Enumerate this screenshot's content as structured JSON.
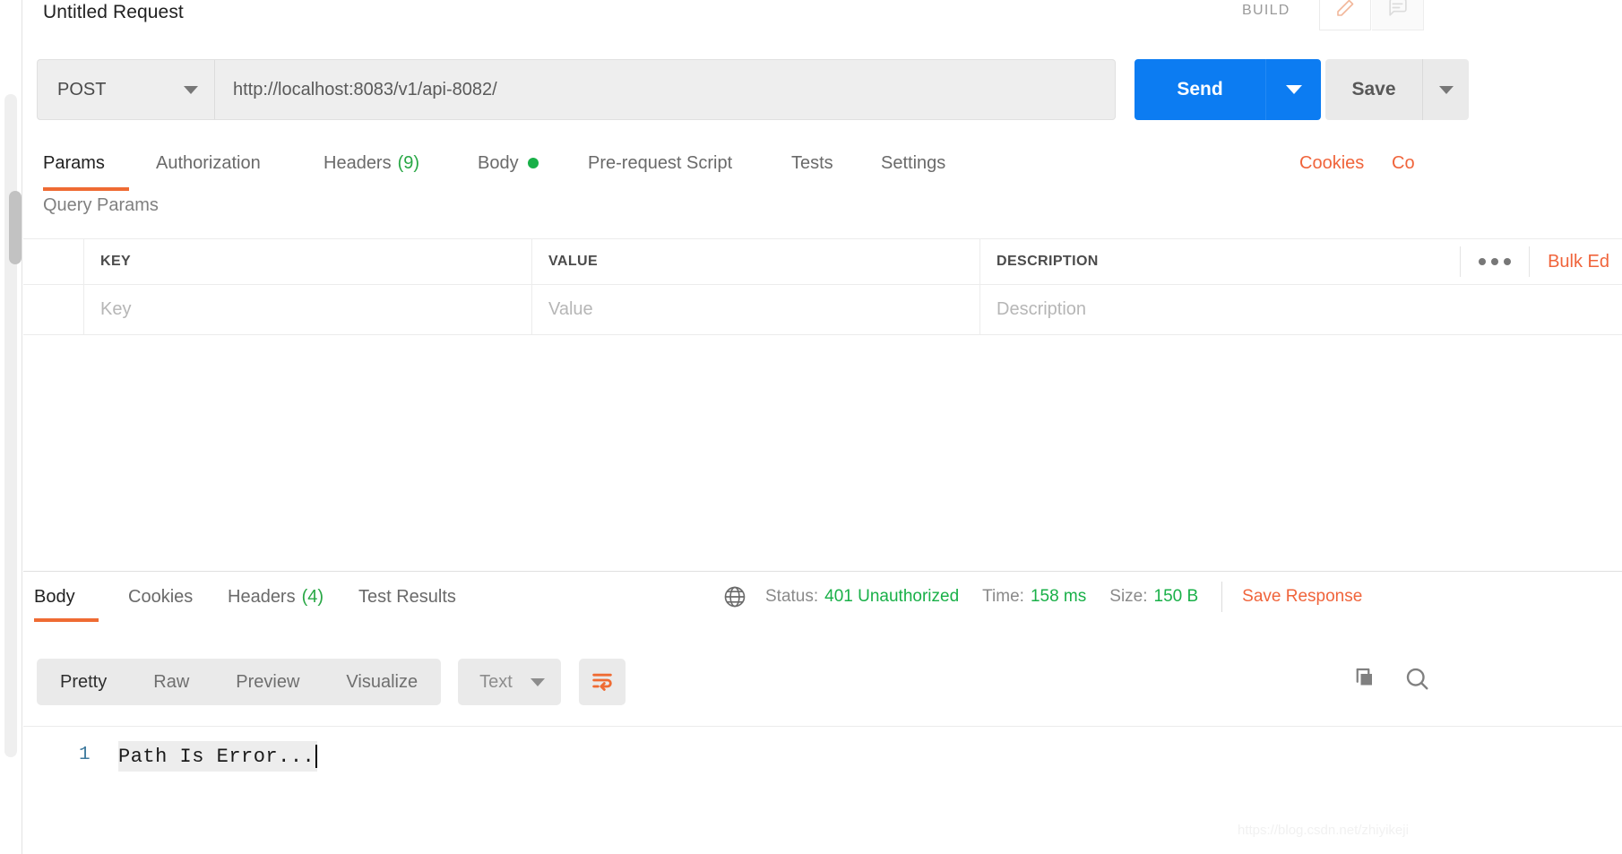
{
  "request": {
    "title": "Untitled Request",
    "build_label": "BUILD",
    "edit_icon": "pencil-icon",
    "comment_icon": "comment-icon",
    "method": "POST",
    "url": "http://localhost:8083/v1/api-8082/",
    "send_label": "Send",
    "save_label": "Save",
    "tabs": [
      {
        "label": "Params",
        "count": "",
        "active": true,
        "dot": false
      },
      {
        "label": "Authorization",
        "count": "",
        "active": false,
        "dot": false
      },
      {
        "label": "Headers",
        "count": "(9)",
        "active": false,
        "dot": false
      },
      {
        "label": "Body",
        "count": "",
        "active": false,
        "dot": true
      },
      {
        "label": "Pre-request Script",
        "count": "",
        "active": false,
        "dot": false
      },
      {
        "label": "Tests",
        "count": "",
        "active": false,
        "dot": false
      },
      {
        "label": "Settings",
        "count": "",
        "active": false,
        "dot": false
      }
    ],
    "links": [
      {
        "label": "Cookies"
      },
      {
        "label": "Co"
      }
    ]
  },
  "params": {
    "section_title": "Query Params",
    "columns": [
      "KEY",
      "VALUE",
      "DESCRIPTION"
    ],
    "rows": [
      {
        "key": "Key",
        "value": "Value",
        "description": "Description"
      }
    ],
    "more_icon": "ellipsis-icon",
    "bulk_edit_label": "Bulk Ed"
  },
  "response": {
    "tabs": [
      {
        "label": "Body",
        "count": "",
        "active": true
      },
      {
        "label": "Cookies",
        "count": "",
        "active": false
      },
      {
        "label": "Headers",
        "count": "(4)",
        "active": false
      },
      {
        "label": "Test Results",
        "count": "",
        "active": false
      }
    ],
    "network_icon": "globe-icon",
    "status_label": "Status:",
    "status_value": "401 Unauthorized",
    "time_label": "Time:",
    "time_value": "158 ms",
    "size_label": "Size:",
    "size_value": "150 B",
    "save_response_label": "Save Response",
    "format_tabs": [
      {
        "label": "Pretty",
        "active": true
      },
      {
        "label": "Raw",
        "active": false
      },
      {
        "label": "Preview",
        "active": false
      },
      {
        "label": "Visualize",
        "active": false
      }
    ],
    "language": "Text",
    "wrap_icon": "word-wrap-icon",
    "copy_icon": "copy-icon",
    "search_icon": "search-icon",
    "body_lines": [
      {
        "number": "1",
        "text": "Path Is Error..."
      }
    ]
  },
  "watermark": "https://blog.csdn.net/zhiyikeji",
  "colors": {
    "accent_orange": "#ef6b33",
    "link_orange": "#f0643b",
    "send_blue": "#0c7cf2",
    "status_green": "#19b048"
  }
}
